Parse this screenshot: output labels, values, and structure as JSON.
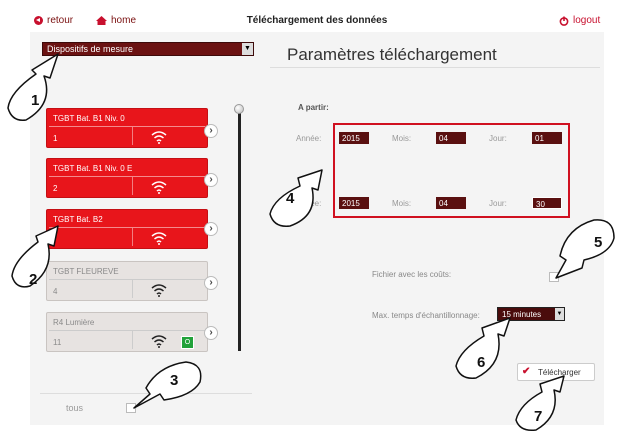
{
  "header": {
    "back_label": "retour",
    "home_label": "home",
    "title": "Téléchargement des données",
    "logout_label": "logout"
  },
  "device_select": {
    "value": "Dispositifs de mesure"
  },
  "devices": [
    {
      "name": "TGBT Bat. B1 Niv. 0",
      "num": "1",
      "state": "red"
    },
    {
      "name": "TGBT Bat. B1 Niv. 0 E",
      "num": "2",
      "state": "red"
    },
    {
      "name": "TGBT Bat. B2",
      "num": "",
      "state": "red"
    },
    {
      "name": "TGBT FLEUREVE",
      "num": "4",
      "state": "grey"
    },
    {
      "name": "R4 Lumière",
      "num": "11",
      "state": "grey",
      "badge": "O"
    }
  ],
  "footer": {
    "tous_label": "tous"
  },
  "panel": {
    "title": "Paramètres téléchargement",
    "from_label": "A partir:",
    "from": {
      "year_label": "Année:",
      "year": "2015",
      "month_label": "Mois:",
      "month": "04",
      "day_label": "Jour:",
      "day": "01"
    },
    "to": {
      "year_label": "Année:",
      "year": "2015",
      "month_label": "Mois:",
      "month": "04",
      "day_label": "Jour:",
      "day": "30"
    },
    "costs_label": "Fichier avec les coûts:",
    "sampling_label": "Max. temps d'échantillonnage:",
    "sampling_value": "15 minutes",
    "download_label": "Télécharger"
  },
  "callouts": [
    "1",
    "2",
    "3",
    "4",
    "5",
    "6",
    "7"
  ],
  "colors": {
    "accent": "#e8151b",
    "dark_field": "#5a1010",
    "highlight": "#d01020"
  }
}
